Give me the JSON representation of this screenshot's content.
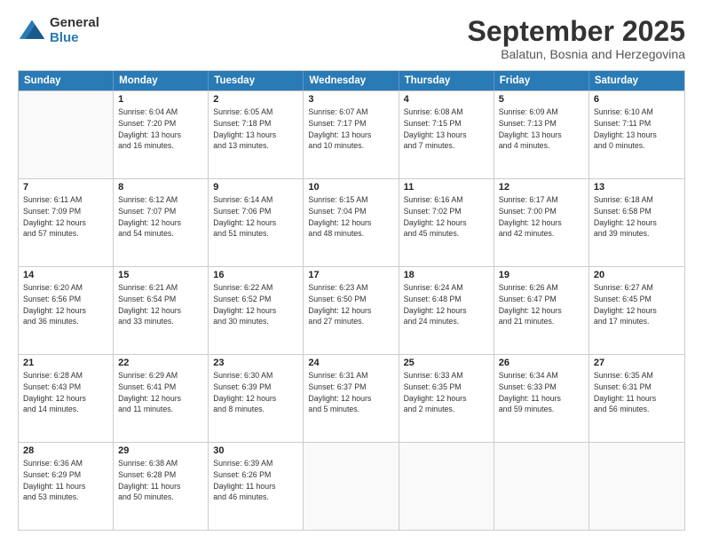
{
  "logo": {
    "general": "General",
    "blue": "Blue"
  },
  "title": "September 2025",
  "subtitle": "Balatun, Bosnia and Herzegovina",
  "header_days": [
    "Sunday",
    "Monday",
    "Tuesday",
    "Wednesday",
    "Thursday",
    "Friday",
    "Saturday"
  ],
  "weeks": [
    [
      {
        "day": "",
        "sunrise": "",
        "sunset": "",
        "daylight": ""
      },
      {
        "day": "1",
        "sunrise": "Sunrise: 6:04 AM",
        "sunset": "Sunset: 7:20 PM",
        "daylight": "Daylight: 13 hours and 16 minutes."
      },
      {
        "day": "2",
        "sunrise": "Sunrise: 6:05 AM",
        "sunset": "Sunset: 7:18 PM",
        "daylight": "Daylight: 13 hours and 13 minutes."
      },
      {
        "day": "3",
        "sunrise": "Sunrise: 6:07 AM",
        "sunset": "Sunset: 7:17 PM",
        "daylight": "Daylight: 13 hours and 10 minutes."
      },
      {
        "day": "4",
        "sunrise": "Sunrise: 6:08 AM",
        "sunset": "Sunset: 7:15 PM",
        "daylight": "Daylight: 13 hours and 7 minutes."
      },
      {
        "day": "5",
        "sunrise": "Sunrise: 6:09 AM",
        "sunset": "Sunset: 7:13 PM",
        "daylight": "Daylight: 13 hours and 4 minutes."
      },
      {
        "day": "6",
        "sunrise": "Sunrise: 6:10 AM",
        "sunset": "Sunset: 7:11 PM",
        "daylight": "Daylight: 13 hours and 0 minutes."
      }
    ],
    [
      {
        "day": "7",
        "sunrise": "Sunrise: 6:11 AM",
        "sunset": "Sunset: 7:09 PM",
        "daylight": "Daylight: 12 hours and 57 minutes."
      },
      {
        "day": "8",
        "sunrise": "Sunrise: 6:12 AM",
        "sunset": "Sunset: 7:07 PM",
        "daylight": "Daylight: 12 hours and 54 minutes."
      },
      {
        "day": "9",
        "sunrise": "Sunrise: 6:14 AM",
        "sunset": "Sunset: 7:06 PM",
        "daylight": "Daylight: 12 hours and 51 minutes."
      },
      {
        "day": "10",
        "sunrise": "Sunrise: 6:15 AM",
        "sunset": "Sunset: 7:04 PM",
        "daylight": "Daylight: 12 hours and 48 minutes."
      },
      {
        "day": "11",
        "sunrise": "Sunrise: 6:16 AM",
        "sunset": "Sunset: 7:02 PM",
        "daylight": "Daylight: 12 hours and 45 minutes."
      },
      {
        "day": "12",
        "sunrise": "Sunrise: 6:17 AM",
        "sunset": "Sunset: 7:00 PM",
        "daylight": "Daylight: 12 hours and 42 minutes."
      },
      {
        "day": "13",
        "sunrise": "Sunrise: 6:18 AM",
        "sunset": "Sunset: 6:58 PM",
        "daylight": "Daylight: 12 hours and 39 minutes."
      }
    ],
    [
      {
        "day": "14",
        "sunrise": "Sunrise: 6:20 AM",
        "sunset": "Sunset: 6:56 PM",
        "daylight": "Daylight: 12 hours and 36 minutes."
      },
      {
        "day": "15",
        "sunrise": "Sunrise: 6:21 AM",
        "sunset": "Sunset: 6:54 PM",
        "daylight": "Daylight: 12 hours and 33 minutes."
      },
      {
        "day": "16",
        "sunrise": "Sunrise: 6:22 AM",
        "sunset": "Sunset: 6:52 PM",
        "daylight": "Daylight: 12 hours and 30 minutes."
      },
      {
        "day": "17",
        "sunrise": "Sunrise: 6:23 AM",
        "sunset": "Sunset: 6:50 PM",
        "daylight": "Daylight: 12 hours and 27 minutes."
      },
      {
        "day": "18",
        "sunrise": "Sunrise: 6:24 AM",
        "sunset": "Sunset: 6:48 PM",
        "daylight": "Daylight: 12 hours and 24 minutes."
      },
      {
        "day": "19",
        "sunrise": "Sunrise: 6:26 AM",
        "sunset": "Sunset: 6:47 PM",
        "daylight": "Daylight: 12 hours and 21 minutes."
      },
      {
        "day": "20",
        "sunrise": "Sunrise: 6:27 AM",
        "sunset": "Sunset: 6:45 PM",
        "daylight": "Daylight: 12 hours and 17 minutes."
      }
    ],
    [
      {
        "day": "21",
        "sunrise": "Sunrise: 6:28 AM",
        "sunset": "Sunset: 6:43 PM",
        "daylight": "Daylight: 12 hours and 14 minutes."
      },
      {
        "day": "22",
        "sunrise": "Sunrise: 6:29 AM",
        "sunset": "Sunset: 6:41 PM",
        "daylight": "Daylight: 12 hours and 11 minutes."
      },
      {
        "day": "23",
        "sunrise": "Sunrise: 6:30 AM",
        "sunset": "Sunset: 6:39 PM",
        "daylight": "Daylight: 12 hours and 8 minutes."
      },
      {
        "day": "24",
        "sunrise": "Sunrise: 6:31 AM",
        "sunset": "Sunset: 6:37 PM",
        "daylight": "Daylight: 12 hours and 5 minutes."
      },
      {
        "day": "25",
        "sunrise": "Sunrise: 6:33 AM",
        "sunset": "Sunset: 6:35 PM",
        "daylight": "Daylight: 12 hours and 2 minutes."
      },
      {
        "day": "26",
        "sunrise": "Sunrise: 6:34 AM",
        "sunset": "Sunset: 6:33 PM",
        "daylight": "Daylight: 11 hours and 59 minutes."
      },
      {
        "day": "27",
        "sunrise": "Sunrise: 6:35 AM",
        "sunset": "Sunset: 6:31 PM",
        "daylight": "Daylight: 11 hours and 56 minutes."
      }
    ],
    [
      {
        "day": "28",
        "sunrise": "Sunrise: 6:36 AM",
        "sunset": "Sunset: 6:29 PM",
        "daylight": "Daylight: 11 hours and 53 minutes."
      },
      {
        "day": "29",
        "sunrise": "Sunrise: 6:38 AM",
        "sunset": "Sunset: 6:28 PM",
        "daylight": "Daylight: 11 hours and 50 minutes."
      },
      {
        "day": "30",
        "sunrise": "Sunrise: 6:39 AM",
        "sunset": "Sunset: 6:26 PM",
        "daylight": "Daylight: 11 hours and 46 minutes."
      },
      {
        "day": "",
        "sunrise": "",
        "sunset": "",
        "daylight": ""
      },
      {
        "day": "",
        "sunrise": "",
        "sunset": "",
        "daylight": ""
      },
      {
        "day": "",
        "sunrise": "",
        "sunset": "",
        "daylight": ""
      },
      {
        "day": "",
        "sunrise": "",
        "sunset": "",
        "daylight": ""
      }
    ]
  ]
}
